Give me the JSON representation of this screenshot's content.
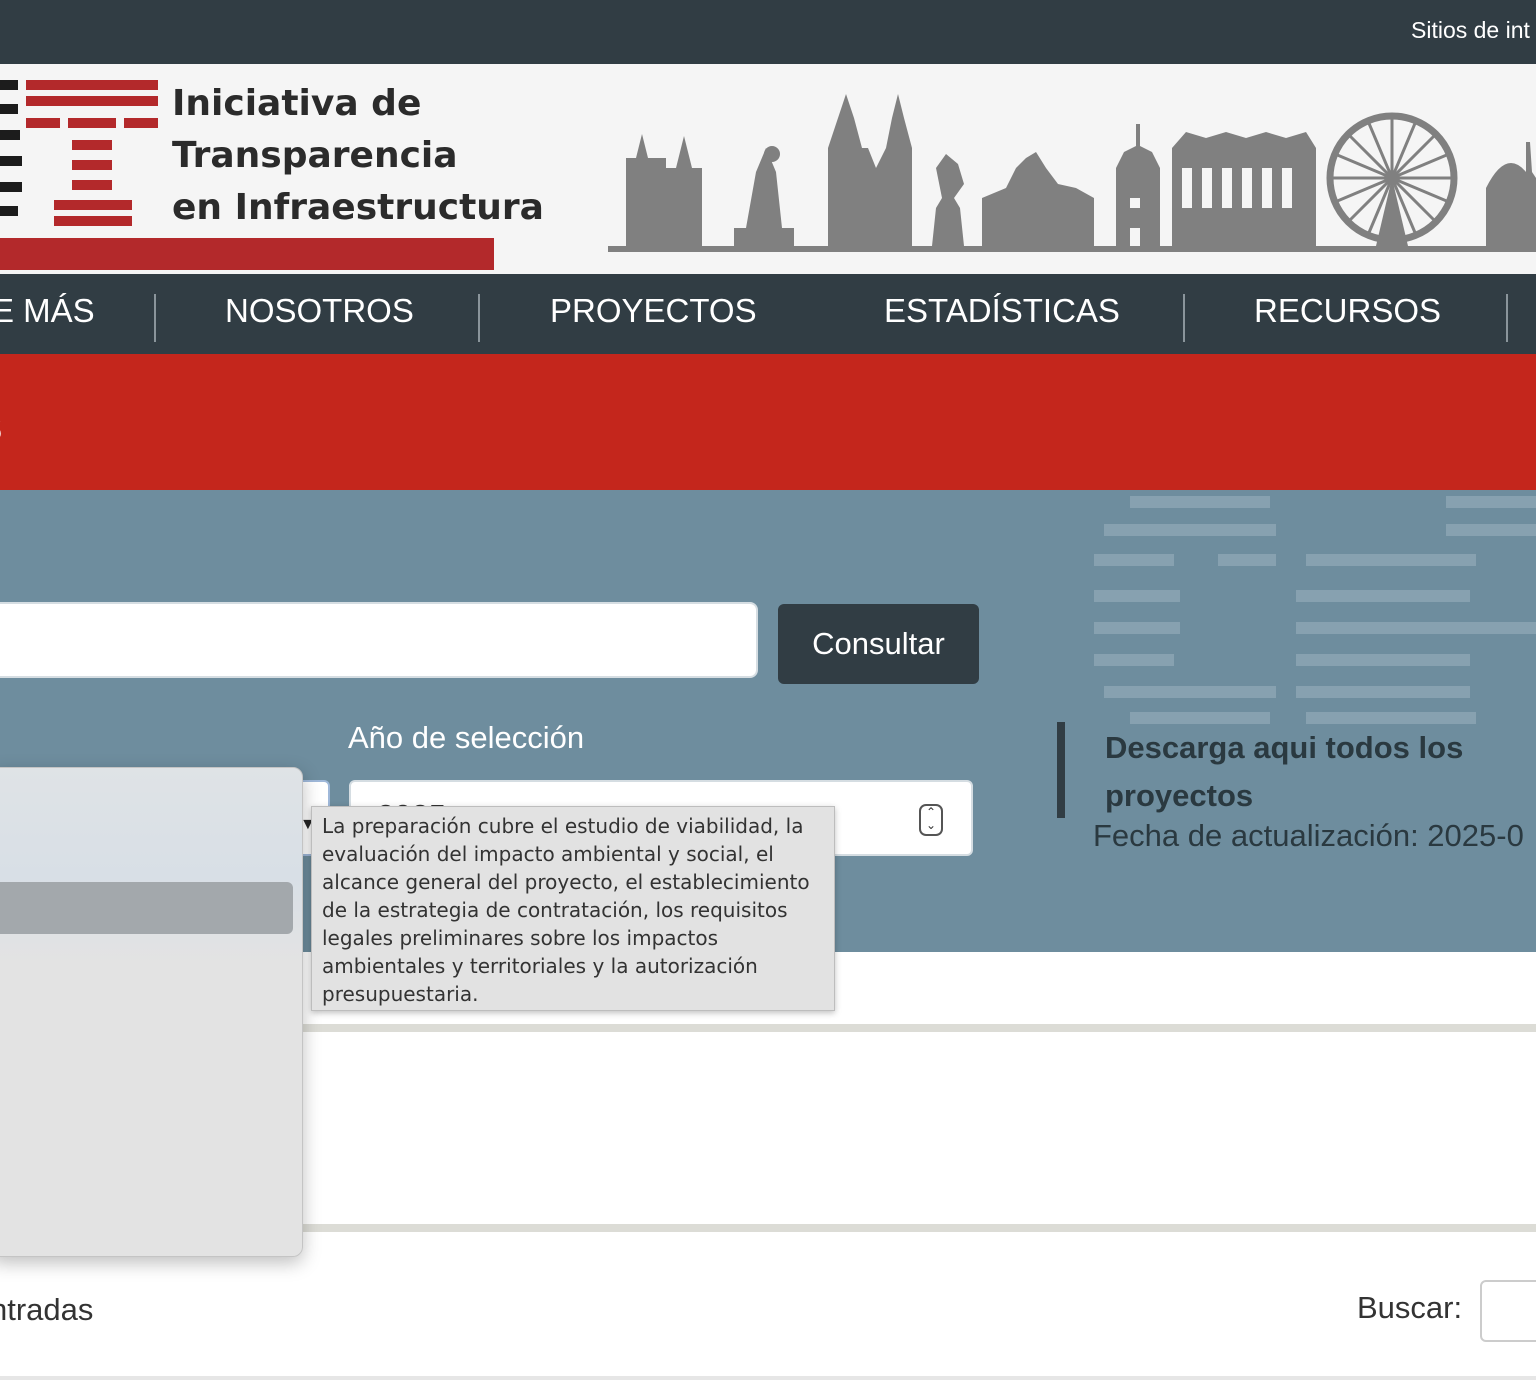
{
  "topbar": {
    "sites_text": "Sitios de int"
  },
  "header": {
    "logo_lines": [
      "Iniciativa de",
      "Transparencia",
      "en Infraestructura"
    ]
  },
  "nav": {
    "items": [
      "E MÁS",
      "NOSOTROS",
      "PROYECTOS",
      "ESTADÍSTICAS",
      "RECURSOS"
    ]
  },
  "banner": {
    "title_fragment": "s"
  },
  "search": {
    "button_label": "Consultar",
    "year_label": "Año de selección",
    "year_value": "2025",
    "download_label": "Descarga aqui todos los proyectos",
    "update_text": "Fecha de actualización: 2025-0"
  },
  "tooltip": {
    "text": "La preparación cubre el estudio de viabilidad, la evaluación del impacto ambiental y social, el alcance general del proyecto, el establecimiento de la estrategia de contratación, los requisitos legales preliminares sobre los impactos ambientales y territoriales y la autorización presupuestaria."
  },
  "table": {
    "entries_fragment": "ntradas",
    "search_label": "Buscar:"
  },
  "colors": {
    "dark": "#313d44",
    "red": "#c4261c",
    "logo_red": "#b3292b",
    "panel": "#6e8d9e"
  }
}
